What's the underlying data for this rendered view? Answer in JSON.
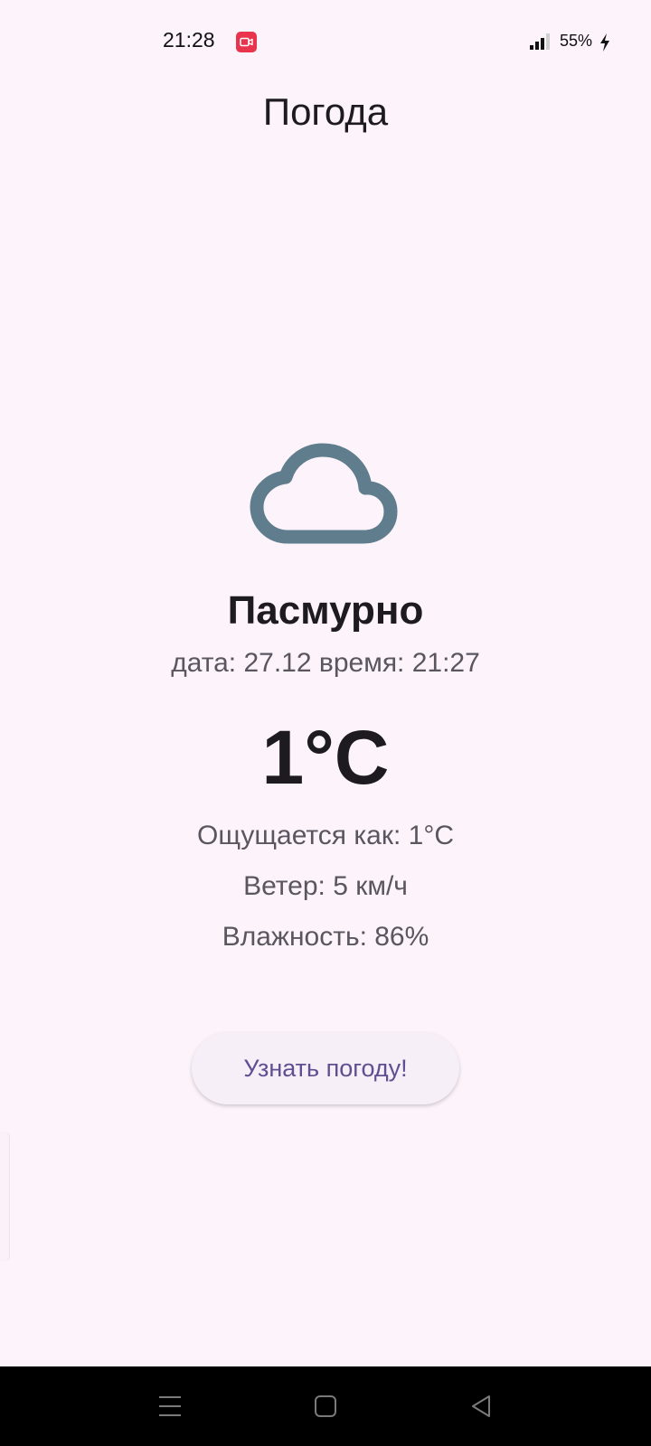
{
  "status_bar": {
    "time": "21:28",
    "battery": "55%",
    "icons": [
      "screen-record-icon",
      "signal-icon",
      "charging-bolt-icon"
    ]
  },
  "app": {
    "title": "Погода"
  },
  "weather": {
    "icon": "cloud-icon",
    "condition": "Пасмурно",
    "datetime": "дата: 27.12 время: 21:27",
    "temperature": "1°C",
    "feels_like": "Ощущается как: 1°C",
    "wind": "Ветер: 5 км/ч",
    "humidity": "Влажность: 86%"
  },
  "action": {
    "button_label": "Узнать погоду!"
  },
  "nav_bar": {
    "icons": [
      "menu-icon",
      "home-icon",
      "back-icon"
    ]
  },
  "colors": {
    "background": "#fdf3fb",
    "cloud": "#5f7d8c",
    "button_text": "#5f4f92",
    "record_badge": "#e8344c"
  }
}
